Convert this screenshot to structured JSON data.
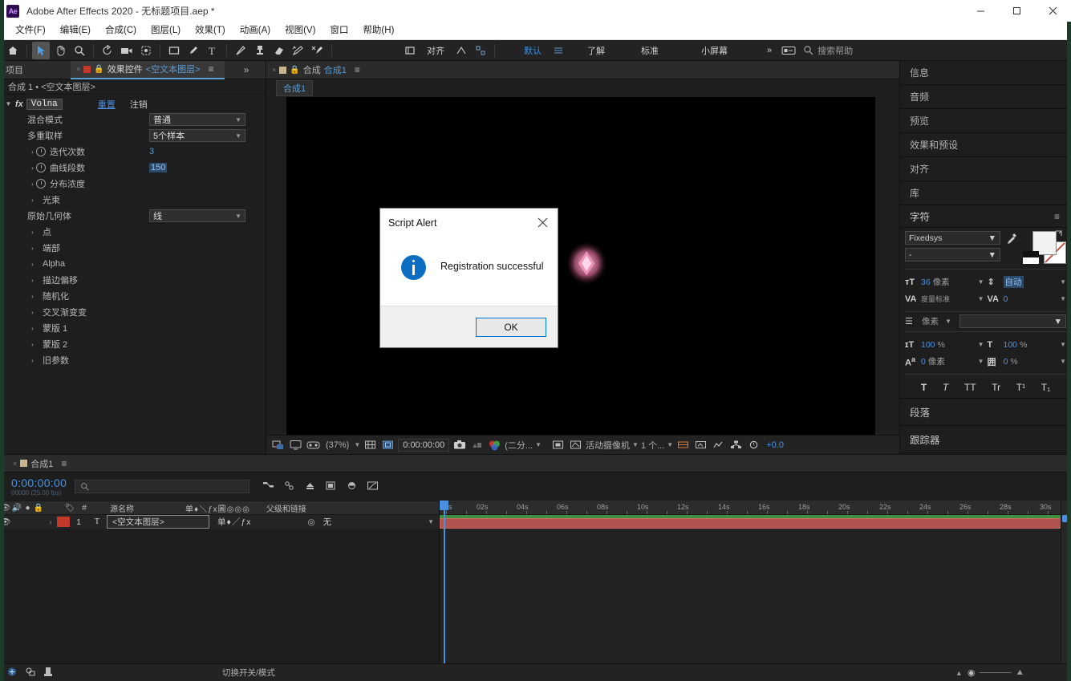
{
  "titlebar": {
    "app_title": "Adobe After Effects 2020 - 无标题项目.aep *",
    "logo": "Ae",
    "minimize": "minimize-icon",
    "maximize": "maximize-icon",
    "close": "close-icon"
  },
  "menubar": {
    "items": [
      {
        "label": "文件(F)"
      },
      {
        "label": "编辑(E)"
      },
      {
        "label": "合成(C)"
      },
      {
        "label": "图层(L)"
      },
      {
        "label": "效果(T)"
      },
      {
        "label": "动画(A)"
      },
      {
        "label": "视图(V)"
      },
      {
        "label": "窗口"
      },
      {
        "label": "帮助(H)"
      }
    ]
  },
  "toolbar": {
    "align_label": "对齐",
    "workspace_default": "默认",
    "workspace_learn": "了解",
    "workspace_standard": "标准",
    "workspace_small": "小屏幕",
    "overflow": "»",
    "search_placeholder": "搜索帮助"
  },
  "effect_controls": {
    "tab_project": "项目",
    "tab_effect_controls": "效果控件",
    "tab_layer_name": "<空文本图层>",
    "breadcrumb": "合成 1 • <空文本图层>",
    "effect_name": "Volna",
    "btn_reset": "重置",
    "btn_logout": "注销",
    "properties": [
      {
        "label": "混合模式",
        "type": "dropdown",
        "value": "普通"
      },
      {
        "label": "多重取样",
        "type": "dropdown",
        "value": "5个样本"
      },
      {
        "label": "迭代次数",
        "type": "value",
        "value": "3",
        "stopwatch": true
      },
      {
        "label": "曲线段数",
        "type": "value-selected",
        "value": "150",
        "stopwatch": true
      },
      {
        "label": "分布浓度",
        "type": "group",
        "value": "",
        "stopwatch": true
      },
      {
        "label": "光束",
        "type": "group",
        "value": ""
      },
      {
        "label": "原始几何体",
        "type": "dropdown",
        "value": "线"
      },
      {
        "label": "点",
        "type": "group",
        "value": ""
      },
      {
        "label": "端部",
        "type": "group",
        "value": ""
      },
      {
        "label": "Alpha",
        "type": "group",
        "value": ""
      },
      {
        "label": "描边偏移",
        "type": "group",
        "value": ""
      },
      {
        "label": "随机化",
        "type": "group",
        "value": ""
      },
      {
        "label": "交叉渐变变",
        "type": "group",
        "value": ""
      },
      {
        "label": "蒙版 1",
        "type": "group",
        "value": ""
      },
      {
        "label": "蒙版 2",
        "type": "group",
        "value": ""
      },
      {
        "label": "旧参数",
        "type": "group",
        "value": ""
      }
    ]
  },
  "composition": {
    "tab_label": "合成",
    "tab_name": "合成1",
    "breadcrumb_chip": "合成1",
    "footer": {
      "zoom": "(37%)",
      "timecode": "0:00:00:00",
      "resolution": "(二分...",
      "camera": "活动摄像机",
      "views": "1 个...",
      "exposure": "+0.0"
    }
  },
  "right_panels": [
    {
      "label": "信息"
    },
    {
      "label": "音频"
    },
    {
      "label": "预览"
    },
    {
      "label": "效果和预设"
    },
    {
      "label": "对齐"
    },
    {
      "label": "库"
    }
  ],
  "character_panel": {
    "title": "字符",
    "font_family": "Fixedsys",
    "font_style": "-",
    "font_size": "36",
    "font_size_unit": "像素",
    "leading": "自动",
    "tracking_label": "度量标准",
    "tracking": "0",
    "stroke_width": "像素",
    "vertical_scale": "100",
    "horizontal_scale": "100",
    "percent": "%",
    "baseline_shift": "0",
    "baseline_unit": "像素",
    "tsume": "0",
    "tsume_unit": "%",
    "style_buttons": [
      "T",
      "T",
      "TT",
      "Tr",
      "T¹",
      "T₁"
    ]
  },
  "paragraph_panel": {
    "label": "段落"
  },
  "tracker_panel": {
    "label": "跟踪器"
  },
  "timeline": {
    "tab_name": "合成1",
    "current_time": "0:00:00:00",
    "frame_info": "00000 (25.00 fps)",
    "search_placeholder": "",
    "columns": {
      "source_name": "源名称",
      "parent_link": "父级和链接",
      "index": "#"
    },
    "layers": [
      {
        "index": "1",
        "type_icon": "T",
        "name": "<空文本图层>",
        "parent": "无"
      }
    ],
    "ruler_ticks": [
      "0s",
      "02s",
      "04s",
      "06s",
      "08s",
      "10s",
      "12s",
      "14s",
      "16s",
      "18s",
      "20s",
      "22s",
      "24s",
      "26s",
      "28s",
      "30s"
    ],
    "footer_label": "切换开关/模式"
  },
  "dialog": {
    "title": "Script Alert",
    "message": "Registration successful",
    "ok_label": "OK",
    "close_icon": "close-icon",
    "info_icon": "info-icon"
  },
  "colors": {
    "accent_blue": "#4a90e2",
    "layer_bar_red": "#b1544f",
    "layer_bar_green": "#3f8f3f",
    "dialog_button_border": "#0078d7",
    "info_icon_blue": "#0b6ec3"
  }
}
